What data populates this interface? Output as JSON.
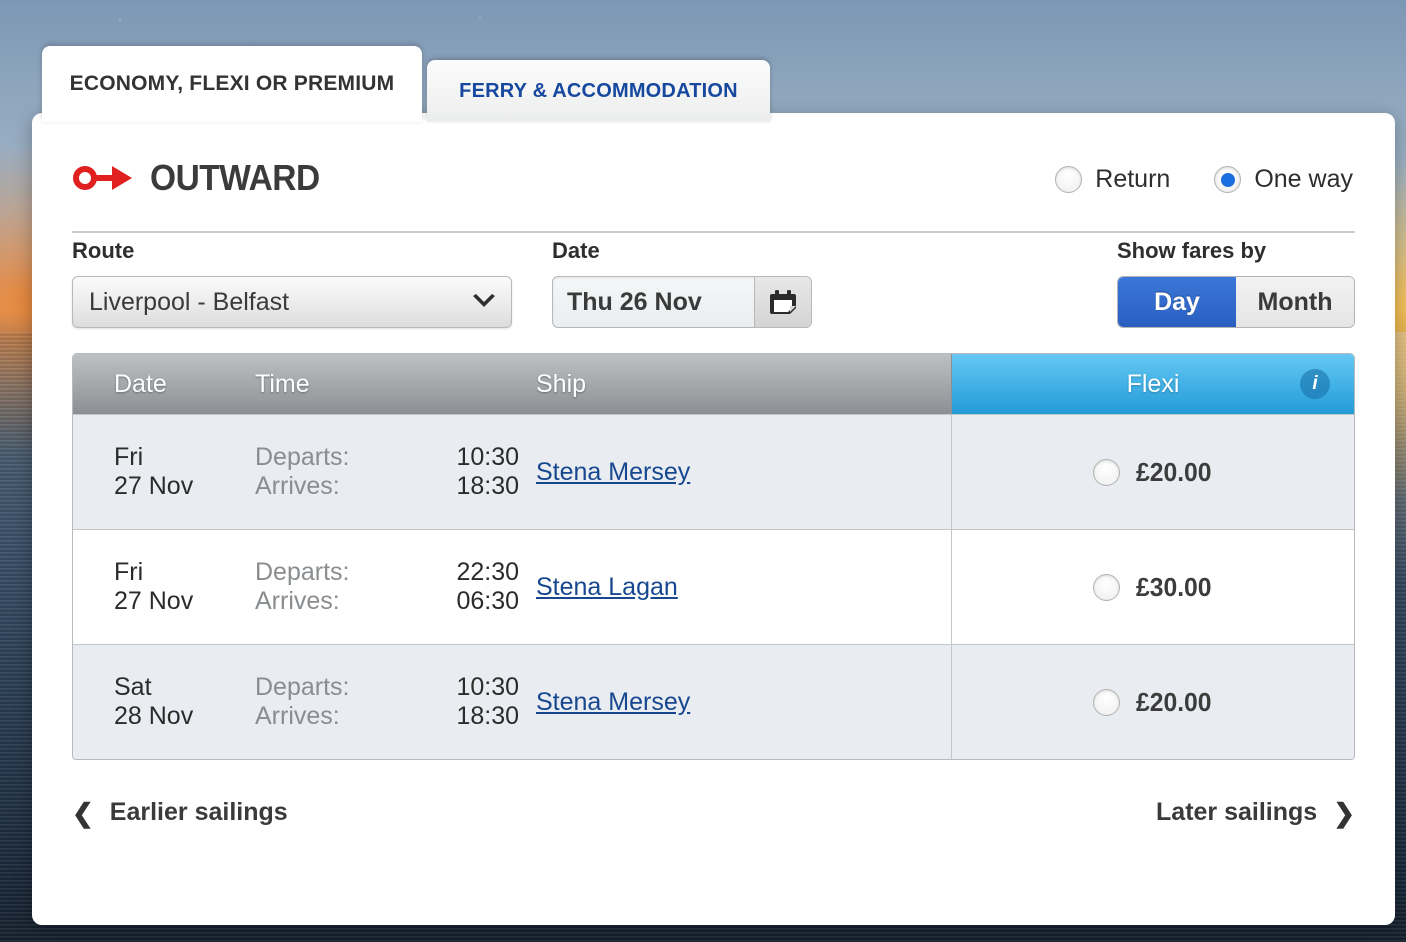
{
  "tabs": [
    {
      "label": "ECONOMY, FLEXI OR PREMIUM",
      "active": true
    },
    {
      "label": "FERRY & ACCOMMODATION",
      "active": false
    }
  ],
  "header": {
    "title": "OUTWARD",
    "direction_icon": "circle-arrow-right-icon",
    "trip_type": {
      "options": [
        {
          "label": "Return",
          "selected": false
        },
        {
          "label": "One way",
          "selected": true
        }
      ]
    }
  },
  "controls": {
    "route": {
      "label": "Route",
      "value": "Liverpool - Belfast",
      "chevron_icon": "chevron-down-icon"
    },
    "date": {
      "label": "Date",
      "value": "Thu 26 Nov",
      "calendar_icon": "calendar-icon"
    },
    "show_fares_by": {
      "label": "Show fares by",
      "options": [
        {
          "label": "Day",
          "selected": true
        },
        {
          "label": "Month",
          "selected": false
        }
      ]
    }
  },
  "table": {
    "columns": {
      "date": "Date",
      "time": "Time",
      "ship": "Ship",
      "fare": "Flexi"
    },
    "fare_info_icon": "info-icon",
    "labels": {
      "departs": "Departs:",
      "arrives": "Arrives:"
    },
    "rows": [
      {
        "day": "Fri",
        "date": "27 Nov",
        "departs": "10:30",
        "arrives": "18:30",
        "ship": "Stena Mersey",
        "price": "£20.00",
        "selected": false
      },
      {
        "day": "Fri",
        "date": "27 Nov",
        "departs": "22:30",
        "arrives": "06:30",
        "ship": "Stena Lagan",
        "price": "£30.00",
        "selected": false
      },
      {
        "day": "Sat",
        "date": "28 Nov",
        "departs": "10:30",
        "arrives": "18:30",
        "ship": "Stena Mersey",
        "price": "£20.00",
        "selected": false
      }
    ]
  },
  "footer": {
    "earlier": "Earlier sailings",
    "later": "Later sailings",
    "earlier_icon": "chevron-left-icon",
    "later_icon": "chevron-right-icon"
  },
  "colors": {
    "accent_blue": "#2a5fc0",
    "fare_header_blue": "#46b4e8",
    "link_blue": "#17488f",
    "arrow_red": "#e0211f",
    "tab_inactive_text": "#15489e"
  }
}
